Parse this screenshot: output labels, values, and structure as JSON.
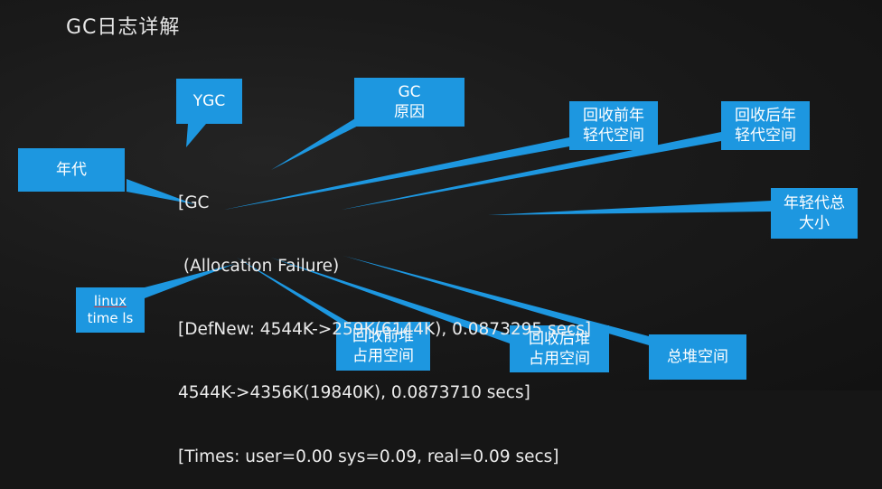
{
  "title": "GC日志详解",
  "log_lines": [
    "[GC",
    " (Allocation Failure)",
    "[DefNew: 4544K->259K(6144K), 0.0873295 secs]",
    "4544K->4356K(19840K), 0.0873710 secs]",
    "[Times: user=0.00 sys=0.09, real=0.09 secs]"
  ],
  "callouts": {
    "ygc": [
      "YGC"
    ],
    "gc_reason": [
      "GC",
      "原因"
    ],
    "generation": [
      "年代"
    ],
    "young_before": [
      "回收前年",
      "轻代空间"
    ],
    "young_after": [
      "回收后年",
      "轻代空间"
    ],
    "young_total": [
      "年轻代总",
      "大小"
    ],
    "linux_time": [
      "linux",
      "time ls"
    ],
    "heap_before": [
      "回收前堆",
      "占用空间"
    ],
    "heap_after": [
      "回收后堆",
      "占用空间"
    ],
    "heap_total": [
      "总堆空间"
    ]
  },
  "colors": {
    "callout_fill": "#1d97e0",
    "text": "#ececec",
    "background": "#1a1a1a"
  }
}
